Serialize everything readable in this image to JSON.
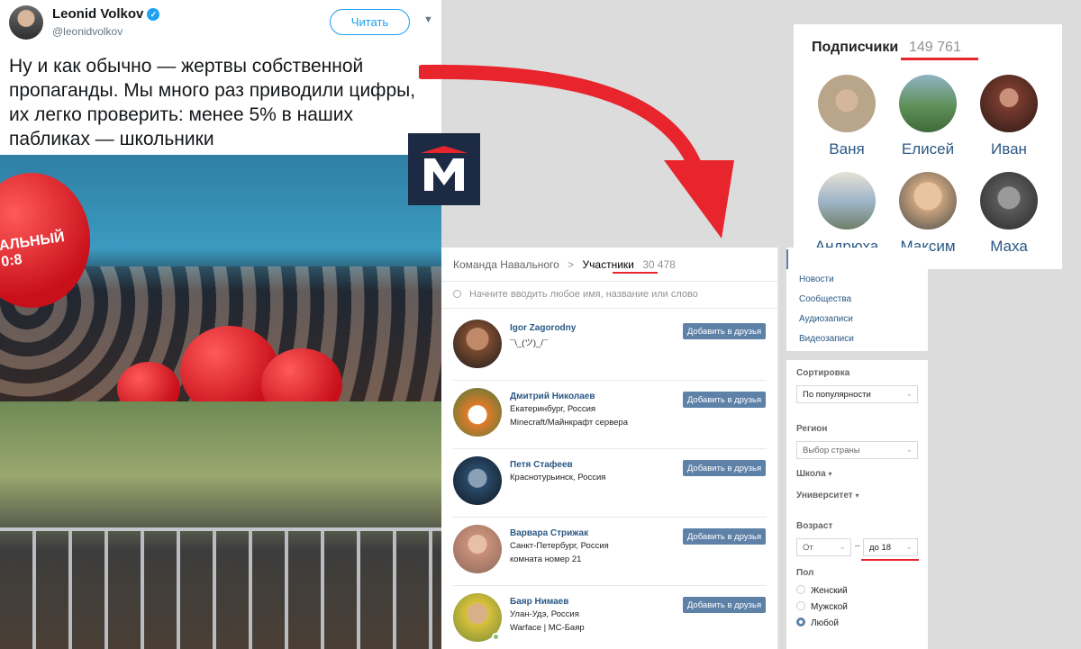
{
  "tweet": {
    "name": "Leonid Volkov",
    "handle": "@leonidvolkov",
    "follow_label": "Читать",
    "text": "Ну и как обычно — жертвы собственной пропаганды. Мы много раз приводили цифры, их легко проверить: менее 5% в наших пабликах — школьники"
  },
  "photo": {
    "banner_text": "АЛЬНЫЙ\n0:8"
  },
  "subscribers": {
    "title": "Подписчики",
    "count": "149 761",
    "people": [
      {
        "name": "Ваня",
        "color": "#b9a58a"
      },
      {
        "name": "Елисей",
        "color": "#5f8f57"
      },
      {
        "name": "Иван",
        "color": "#7a3b2f"
      },
      {
        "name": "Андрюха",
        "color": "#9fb6c9"
      },
      {
        "name": "Максим",
        "color": "#c9a37e"
      },
      {
        "name": "Маха",
        "color": "#5a5a5a"
      }
    ]
  },
  "vk": {
    "breadcrumb_parent": "Команда Навального",
    "breadcrumb_separator": ">",
    "breadcrumb_current": "Участники",
    "members_count": "30 478",
    "search_placeholder": "Начните вводить любое имя, название или слово",
    "add_label": "Добавить в друзья",
    "members": [
      {
        "name": "Igor Zagorodny",
        "line1": "¯\\_(ツ)_/¯",
        "line2": "",
        "color": "#7a4a2f"
      },
      {
        "name": "Дмитрий Николаев",
        "line1": "Екатеринбург, Россия",
        "line2": "Minecraft/Майнкрафт сервера",
        "color": "#e07a2a"
      },
      {
        "name": "Петя Стафеев",
        "line1": "Краснотурьинск, Россия",
        "line2": "",
        "color": "#2a4a6a"
      },
      {
        "name": "Варвара Стрижак",
        "line1": "Санкт-Петербург, Россия",
        "line2": "комната номер 21",
        "color": "#c9907a"
      },
      {
        "name": "Баяр Нимаев",
        "line1": "Улан-Удэ, Россия",
        "line2": "Warface | MC-Баяр",
        "color": "#d8c23a"
      }
    ],
    "menu": [
      "Новости",
      "Сообщества",
      "Аудиозаписи",
      "Видеозаписи"
    ],
    "filters": {
      "sort_label": "Сортировка",
      "sort_value": "По популярности",
      "region_label": "Регион",
      "region_value": "Выбор страны",
      "school_label": "Школа",
      "university_label": "Университет",
      "age_label": "Возраст",
      "age_from": "От",
      "age_dash": "–",
      "age_to": "до 18",
      "gender_label": "Пол",
      "gender_options": [
        "Женский",
        "Мужской",
        "Любой"
      ],
      "gender_selected": "Любой"
    }
  },
  "colors": {
    "vk_link": "#2a5885",
    "vk_button": "#5e81a8",
    "highlight_red": "#e8242c",
    "twitter_blue": "#1da1f2"
  }
}
